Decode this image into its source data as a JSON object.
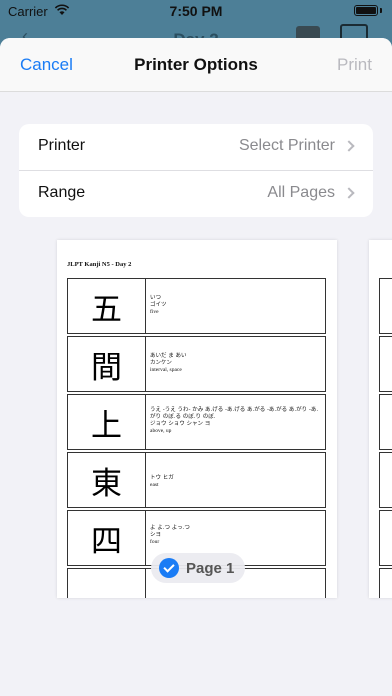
{
  "status_bar": {
    "carrier": "Carrier",
    "time": "7:50 PM"
  },
  "background": {
    "title": "Day 2"
  },
  "header": {
    "cancel": "Cancel",
    "title": "Printer Options",
    "print": "Print"
  },
  "options": [
    {
      "label": "Printer",
      "value": "Select Printer"
    },
    {
      "label": "Range",
      "value": "All Pages"
    }
  ],
  "preview": {
    "heading": "JLPT Kanji N5 - Day 2",
    "rows": [
      {
        "kanji": "五",
        "kun": "いつ",
        "on": "ゴイツ",
        "meaning": "five"
      },
      {
        "kanji": "間",
        "kun": "あいだ ま あい",
        "on": "カンケン",
        "meaning": "interval, space"
      },
      {
        "kanji": "上",
        "kun": "うえ -うえ うわ- かみ あ.げる -あ.げる あ.がる -あ.がる あ.がり -あ.がり のぼ.る のぼ.り のぼ.",
        "on": "ジョウ ショウ シャン ヨ",
        "meaning": "above, up"
      },
      {
        "kanji": "東",
        "kun": "トウ ヒガ",
        "on": "",
        "meaning": "east"
      },
      {
        "kanji": "四",
        "kun": "よ よ.つ よっ.つ",
        "on": "シヨ",
        "meaning": "four"
      }
    ],
    "page_label": "Page 1"
  }
}
